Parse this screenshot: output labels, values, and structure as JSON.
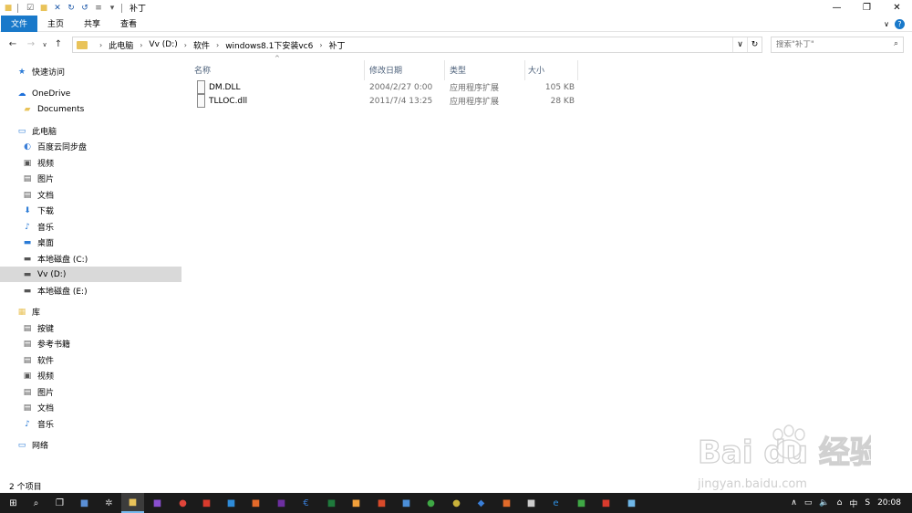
{
  "window": {
    "title": "补丁",
    "controls": {
      "minimize": "—",
      "maximize": "❐",
      "close": "✕"
    }
  },
  "ribbon": {
    "tabs": [
      "文件",
      "主页",
      "共享",
      "查看"
    ],
    "expand": "∨",
    "help": "?"
  },
  "address": {
    "crumbs": [
      "此电脑",
      "Vv (D:)",
      "软件",
      "windows8.1下安装vc6",
      "补丁"
    ],
    "search_placeholder": "搜索\"补丁\""
  },
  "sidebar": {
    "items": [
      {
        "label": "快速访问",
        "icon": "star-icon",
        "glyph": "★",
        "color": "#2b7bd6"
      },
      {
        "label": "OneDrive",
        "icon": "cloud-icon",
        "glyph": "☁",
        "color": "#1e6fd9"
      },
      {
        "label": "Documents",
        "icon": "folder-icon",
        "glyph": "▰",
        "color": "#e9c35a"
      },
      {
        "label": "此电脑",
        "icon": "pc-icon",
        "glyph": "▭",
        "color": "#2b7bd6"
      },
      {
        "label": "百度云同步盘",
        "icon": "cloud-drive-icon",
        "glyph": "◐",
        "color": "#3b7fd8"
      },
      {
        "label": "视频",
        "icon": "video-icon",
        "glyph": "▣",
        "color": "#555555"
      },
      {
        "label": "图片",
        "icon": "picture-icon",
        "glyph": "▤",
        "color": "#555555"
      },
      {
        "label": "文档",
        "icon": "document-icon",
        "glyph": "▤",
        "color": "#555555"
      },
      {
        "label": "下载",
        "icon": "download-icon",
        "glyph": "⬇",
        "color": "#2b7bd6"
      },
      {
        "label": "音乐",
        "icon": "music-icon",
        "glyph": "♪",
        "color": "#2b7bd6"
      },
      {
        "label": "桌面",
        "icon": "desktop-icon",
        "glyph": "▬",
        "color": "#2b7bd6"
      },
      {
        "label": "本地磁盘 (C:)",
        "icon": "drive-icon",
        "glyph": "▬",
        "color": "#555555"
      },
      {
        "label": "Vv (D:)",
        "icon": "drive-icon",
        "glyph": "▬",
        "color": "#555555"
      },
      {
        "label": "本地磁盘 (E:)",
        "icon": "drive-icon",
        "glyph": "▬",
        "color": "#555555"
      },
      {
        "label": "库",
        "icon": "library-icon",
        "glyph": "▦",
        "color": "#e9c35a"
      },
      {
        "label": "按键",
        "icon": "library-item-icon",
        "glyph": "▤",
        "color": "#555555"
      },
      {
        "label": "参考书籍",
        "icon": "library-item-icon",
        "glyph": "▤",
        "color": "#555555"
      },
      {
        "label": "软件",
        "icon": "library-item-icon",
        "glyph": "▤",
        "color": "#555555"
      },
      {
        "label": "视频",
        "icon": "video-icon",
        "glyph": "▣",
        "color": "#555555"
      },
      {
        "label": "图片",
        "icon": "picture-icon",
        "glyph": "▤",
        "color": "#555555"
      },
      {
        "label": "文档",
        "icon": "document-icon",
        "glyph": "▤",
        "color": "#555555"
      },
      {
        "label": "音乐",
        "icon": "music-icon",
        "glyph": "♪",
        "color": "#2b7bd6"
      },
      {
        "label": "网络",
        "icon": "network-icon",
        "glyph": "▭",
        "color": "#2b7bd6"
      }
    ]
  },
  "columns": [
    "名称",
    "修改日期",
    "类型",
    "大小"
  ],
  "files": [
    {
      "name": "DM.DLL",
      "date": "2004/2/27 0:00",
      "type": "应用程序扩展",
      "size": "105 KB"
    },
    {
      "name": "TLLOC.dll",
      "date": "2011/7/4 13:25",
      "type": "应用程序扩展",
      "size": "28 KB"
    }
  ],
  "status": {
    "count": "2 个项目"
  },
  "taskbar": {
    "apps": [
      {
        "name": "start-icon",
        "glyph": "⊞",
        "color": "#ffffff"
      },
      {
        "name": "search-icon",
        "glyph": "⌕",
        "color": "#ffffff"
      },
      {
        "name": "task-view-icon",
        "glyph": "❐",
        "color": "#ffffff"
      },
      {
        "name": "app-icon",
        "glyph": "■",
        "color": "#5a8fd6"
      },
      {
        "name": "app-icon",
        "glyph": "✲",
        "color": "#cccccc"
      },
      {
        "name": "explorer-icon",
        "glyph": "■",
        "color": "#e9c35a"
      },
      {
        "name": "visual-studio-icon",
        "glyph": "■",
        "color": "#8a4fd0"
      },
      {
        "name": "chrome-icon",
        "glyph": "●",
        "color": "#e0453a"
      },
      {
        "name": "pdf-icon",
        "glyph": "■",
        "color": "#d83b2d"
      },
      {
        "name": "app-icon",
        "glyph": "■",
        "color": "#2e8bd8"
      },
      {
        "name": "app-icon",
        "glyph": "■",
        "color": "#e36a2a"
      },
      {
        "name": "app-icon",
        "glyph": "■",
        "color": "#6d2fa0"
      },
      {
        "name": "app-icon",
        "glyph": "€",
        "color": "#3a7fd9"
      },
      {
        "name": "excel-icon",
        "glyph": "■",
        "color": "#1f7a3c"
      },
      {
        "name": "app-icon",
        "glyph": "■",
        "color": "#f2a03a"
      },
      {
        "name": "app-icon",
        "glyph": "■",
        "color": "#d84a2a"
      },
      {
        "name": "app-icon",
        "glyph": "■",
        "color": "#4c8fd8"
      },
      {
        "name": "app-icon",
        "glyph": "●",
        "color": "#3fa845"
      },
      {
        "name": "app-icon",
        "glyph": "●",
        "color": "#c9b23a"
      },
      {
        "name": "app-icon",
        "glyph": "◆",
        "color": "#3a7fd9"
      },
      {
        "name": "app-icon",
        "glyph": "■",
        "color": "#e06a2a"
      },
      {
        "name": "app-icon",
        "glyph": "■",
        "color": "#cccccc"
      },
      {
        "name": "edge-icon",
        "glyph": "e",
        "color": "#2f8fe0"
      },
      {
        "name": "app-icon",
        "glyph": "■",
        "color": "#3fa845"
      },
      {
        "name": "app-icon",
        "glyph": "■",
        "color": "#d83b2d"
      },
      {
        "name": "app-icon",
        "glyph": "■",
        "color": "#6fb7e8"
      }
    ],
    "tray": {
      "up": "∧",
      "battery": "▭",
      "volume": "🔈",
      "network": "⌂",
      "ime": "中",
      "lang": "S",
      "time": "20:08"
    }
  }
}
